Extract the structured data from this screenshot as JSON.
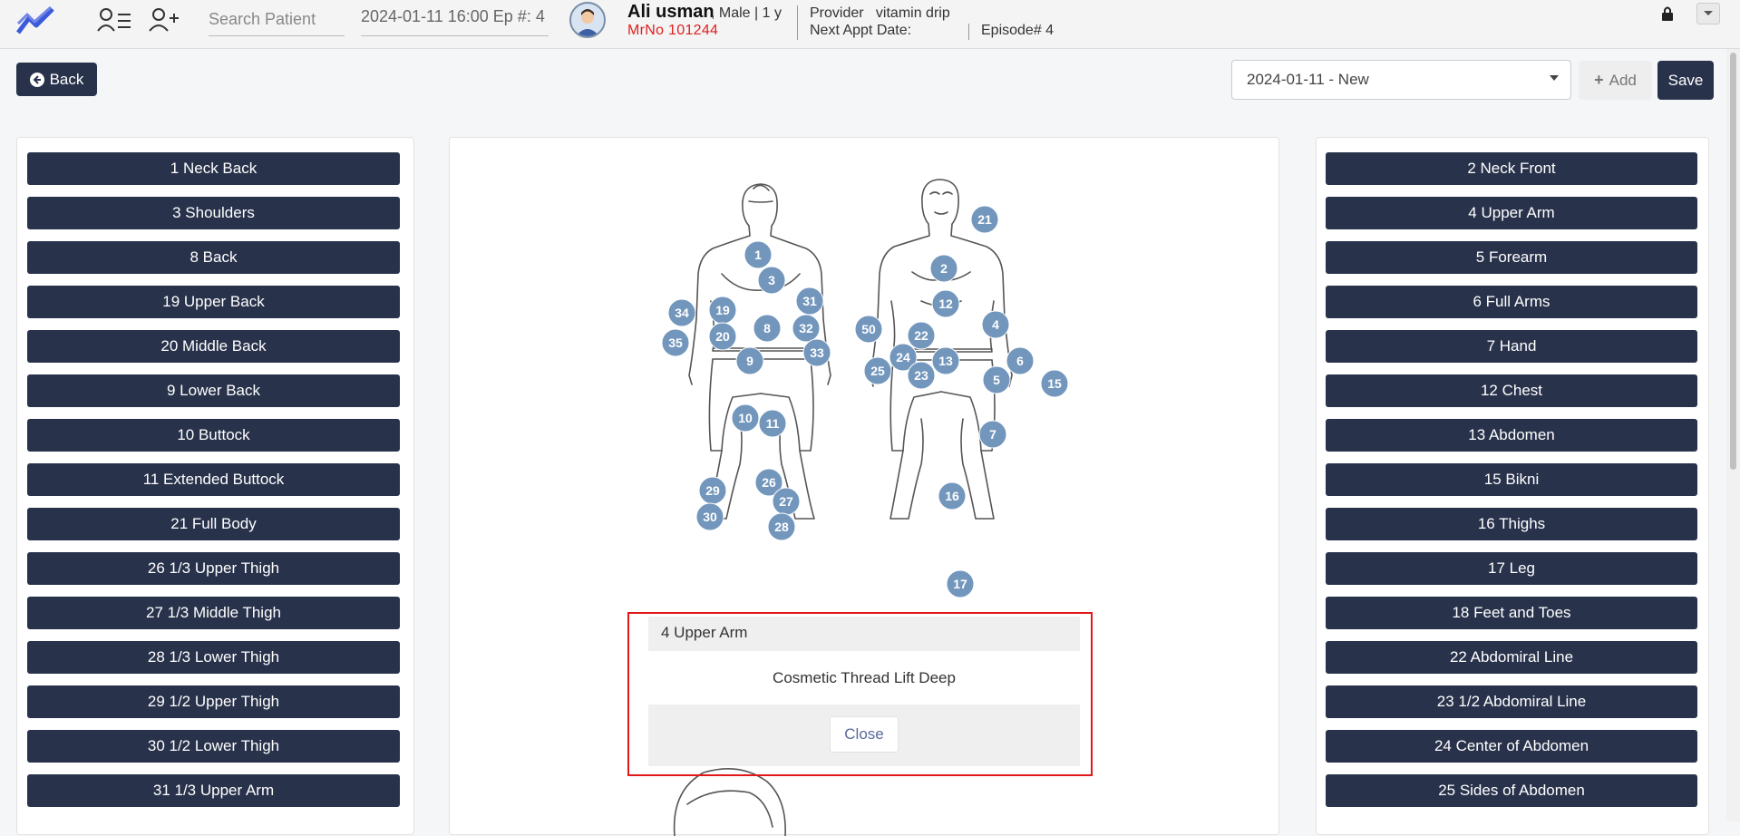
{
  "header": {
    "search_placeholder": "Search Patient",
    "episode_selector": "2024-01-11 16:00 Ep #: 4",
    "patient_name": "Ali usman",
    "patient_details": ", Male | 1 y",
    "mrno": "MrNo 101244",
    "provider_label": "Provider",
    "provider_value": "vitamin drip",
    "next_appt_label": "Next Appt Date:",
    "episode_label": "Episode# 4"
  },
  "toolbar": {
    "back_label": "Back",
    "date_select_value": "2024-01-11 - New",
    "add_label": "Add",
    "save_label": "Save"
  },
  "left_list": [
    "1 Neck Back",
    "3 Shoulders",
    "8 Back",
    "19 Upper Back",
    "20 Middle Back",
    "9 Lower Back",
    "10 Buttock",
    "11 Extended Buttock",
    "21 Full Body",
    "26 1/3 Upper Thigh",
    "27 1/3 Middle Thigh",
    "28 1/3 Lower Thigh",
    "29 1/2 Upper Thigh",
    "30 1/2 Lower Thigh",
    "31 1/3 Upper Arm"
  ],
  "right_list": [
    "2 Neck Front",
    "4 Upper Arm",
    "5 Forearm",
    "6 Full Arms",
    "7 Hand",
    "12 Chest",
    "13 Abdomen",
    "15 Bikni",
    "16 Thighs",
    "17 Leg",
    "18 Feet and Toes",
    "22 Abdomiral Line",
    "23 1/2 Abdomiral Line",
    "24 Center of Abdomen",
    "25 Sides of Abdomen"
  ],
  "markers": [
    "1",
    "3",
    "34",
    "19",
    "31",
    "8",
    "32",
    "35",
    "20",
    "33",
    "9",
    "10",
    "11",
    "29",
    "26",
    "27",
    "30",
    "28",
    "21",
    "2",
    "12",
    "50",
    "4",
    "22",
    "24",
    "13",
    "6",
    "25",
    "23",
    "5",
    "15",
    "7",
    "16",
    "17"
  ],
  "popup": {
    "title": "4 Upper Arm",
    "body": "Cosmetic Thread Lift Deep",
    "close_label": "Close"
  }
}
